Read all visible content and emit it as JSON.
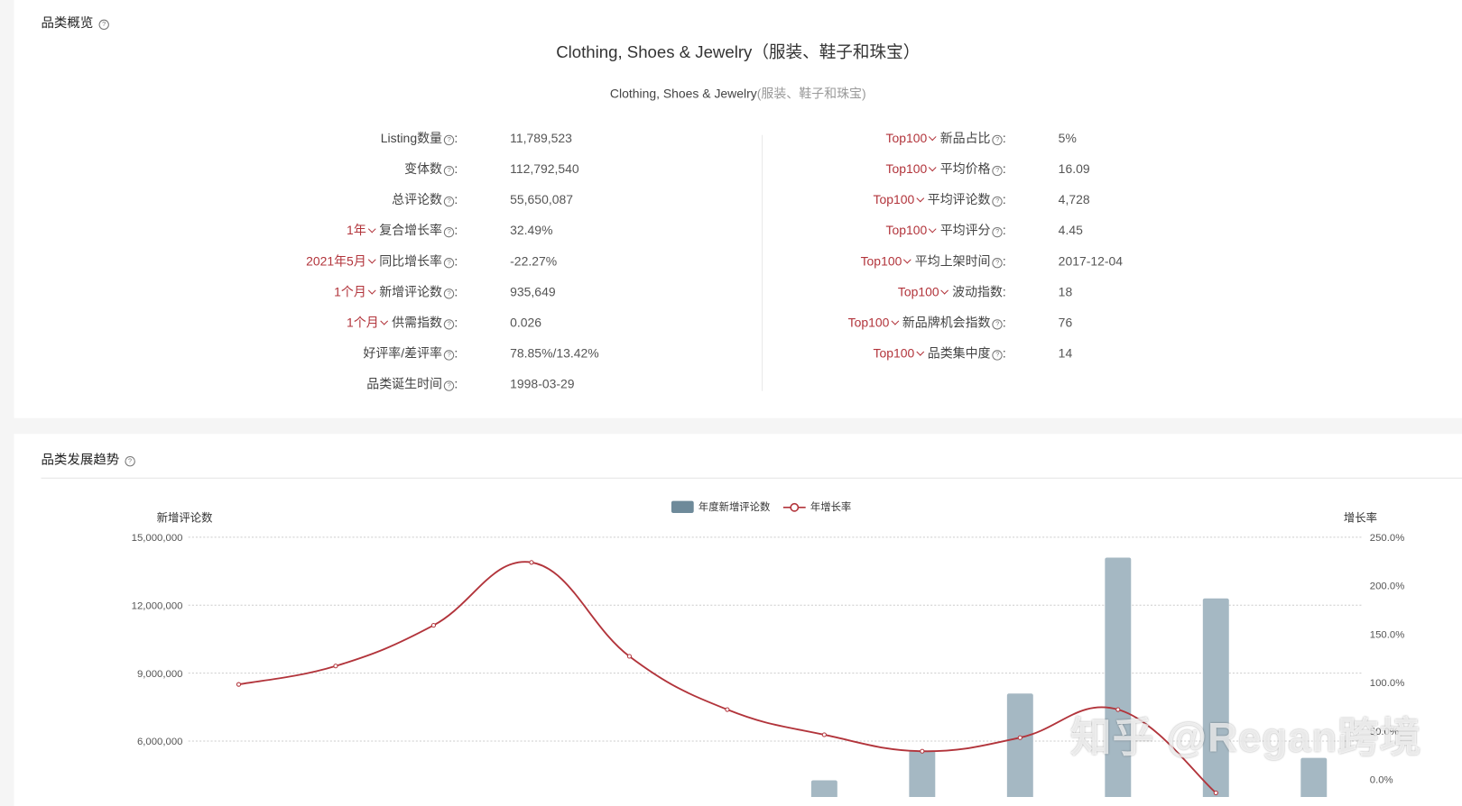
{
  "overview": {
    "section_title": "品类概览",
    "category_title": "Clothing, Shoes & Jewelry（服装、鞋子和珠宝）",
    "breadcrumb_en": "Clothing, Shoes & Jewelry",
    "breadcrumb_cn": "(服装、鞋子和珠宝)",
    "left_metrics": [
      {
        "selector": "",
        "label": "Listing数量",
        "value": "11,789,523"
      },
      {
        "selector": "",
        "label": "变体数",
        "value": "112,792,540"
      },
      {
        "selector": "",
        "label": "总评论数",
        "value": "55,650,087"
      },
      {
        "selector": "1年",
        "label": "复合增长率",
        "value": "32.49%"
      },
      {
        "selector": "2021年5月",
        "label": "同比增长率",
        "value": "-22.27%"
      },
      {
        "selector": "1个月",
        "label": "新增评论数",
        "value": "935,649"
      },
      {
        "selector": "1个月",
        "label": "供需指数",
        "value": "0.026"
      },
      {
        "selector": "",
        "label": "好评率/差评率",
        "value": "78.85%/13.42%"
      },
      {
        "selector": "",
        "label": "品类诞生时间",
        "value": "1998-03-29"
      }
    ],
    "right_metrics": [
      {
        "selector": "Top100",
        "label": "新品占比",
        "value": "5%",
        "help": true
      },
      {
        "selector": "Top100",
        "label": "平均价格",
        "value": "16.09",
        "help": true
      },
      {
        "selector": "Top100",
        "label": "平均评论数",
        "value": "4,728",
        "help": true
      },
      {
        "selector": "Top100",
        "label": "平均评分",
        "value": "4.45",
        "help": true
      },
      {
        "selector": "Top100",
        "label": "平均上架时间",
        "value": "2017-12-04",
        "help": true
      },
      {
        "selector": "Top100",
        "label": "波动指数",
        "value": "18",
        "help": false
      },
      {
        "selector": "Top100",
        "label": "新品牌机会指数",
        "value": "76",
        "help": true
      },
      {
        "selector": "Top100",
        "label": "品类集中度",
        "value": "14",
        "help": true
      }
    ]
  },
  "trend": {
    "section_title": "品类发展趋势"
  },
  "chart_data": {
    "type": "bar",
    "title": "",
    "ylabel": "新增评论数",
    "y2label": "增长率",
    "ylim": [
      0,
      15000000
    ],
    "y_ticks": [
      "15,000,000",
      "12,000,000",
      "9,000,000",
      "6,000,000"
    ],
    "y_tick_values": [
      15000000,
      12000000,
      9000000,
      6000000
    ],
    "y2lim": [
      0,
      250
    ],
    "y2_ticks": [
      "250.0%",
      "200.0%",
      "150.0%",
      "100.0%",
      "50.0%",
      "0.0%"
    ],
    "y2_tick_values": [
      250,
      200,
      150,
      100,
      50,
      0
    ],
    "legend": [
      "年度新增评论数",
      "年增长率"
    ],
    "legend_position": "top-center",
    "colors": {
      "bar": "#a5b8c3",
      "legend_bar": "#6e8a9a",
      "line": "#b2343b"
    },
    "series": [
      {
        "name": "年度新增评论数",
        "type": "bar",
        "values": [
          null,
          null,
          null,
          null,
          null,
          null,
          4270000,
          5590000,
          8100000,
          14100000,
          12300000,
          5260000
        ]
      },
      {
        "name": "年增长率",
        "type": "line",
        "values": [
          98,
          117,
          159,
          224,
          127,
          72,
          46,
          29,
          43,
          72,
          -14,
          null
        ]
      }
    ]
  },
  "watermark": "知乎 @Regan跨境"
}
